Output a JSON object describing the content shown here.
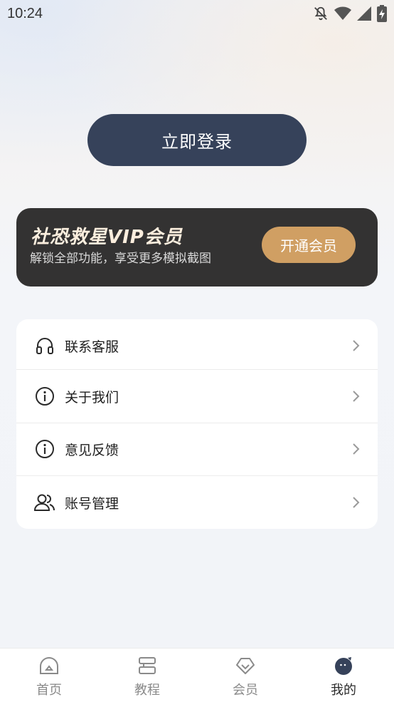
{
  "status_bar": {
    "time": "10:24",
    "icons": [
      "bell-off-icon",
      "wifi-icon",
      "signal-icon",
      "battery-charging-icon"
    ]
  },
  "login": {
    "label": "立即登录"
  },
  "vip": {
    "title": "社恐救星VIP会员",
    "subtitle": "解锁全部功能，享受更多模拟截图",
    "button_label": "开通会员"
  },
  "menu": {
    "items": [
      {
        "label": "联系客服",
        "icon": "headphones-icon"
      },
      {
        "label": "关于我们",
        "icon": "info-icon"
      },
      {
        "label": "意见反馈",
        "icon": "info-icon"
      },
      {
        "label": "账号管理",
        "icon": "users-icon"
      }
    ]
  },
  "nav": {
    "items": [
      {
        "label": "首页",
        "icon": "home-icon"
      },
      {
        "label": "教程",
        "icon": "tutorial-icon"
      },
      {
        "label": "会员",
        "icon": "diamond-icon"
      },
      {
        "label": "我的",
        "icon": "profile-icon",
        "active": true
      }
    ]
  },
  "colors": {
    "primary_dark": "#36425a",
    "vip_card_bg": "#333232",
    "vip_gold": "#d09f63",
    "vip_title": "#fbeede"
  }
}
